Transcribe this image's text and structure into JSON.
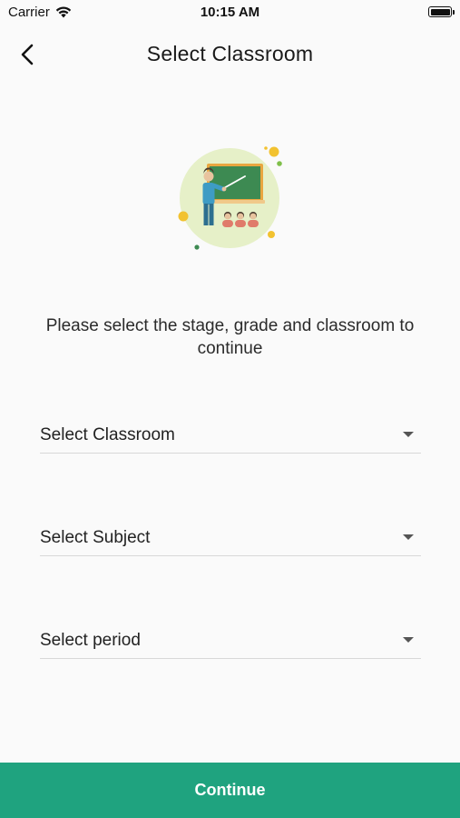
{
  "status_bar": {
    "carrier": "Carrier",
    "time": "10:15 AM",
    "icons": [
      "wifi-icon",
      "battery-icon"
    ]
  },
  "nav": {
    "title": "Select Classroom",
    "back_icon": "chevron-left-icon"
  },
  "illustration": {
    "icon": "teacher-classroom-illustration"
  },
  "instruction": "Please select the stage, grade and classroom to continue",
  "dropdowns": [
    {
      "label": "Select Classroom",
      "icon": "caret-down-icon"
    },
    {
      "label": "Select Subject",
      "icon": "caret-down-icon"
    },
    {
      "label": "Select period",
      "icon": "caret-down-icon"
    }
  ],
  "continue_label": "Continue",
  "colors": {
    "accent": "#1fa37f",
    "background": "#fafafa",
    "illustration_circle": "#e6f0c8",
    "board": "#3d8a52",
    "board_frame": "#e9a640"
  }
}
